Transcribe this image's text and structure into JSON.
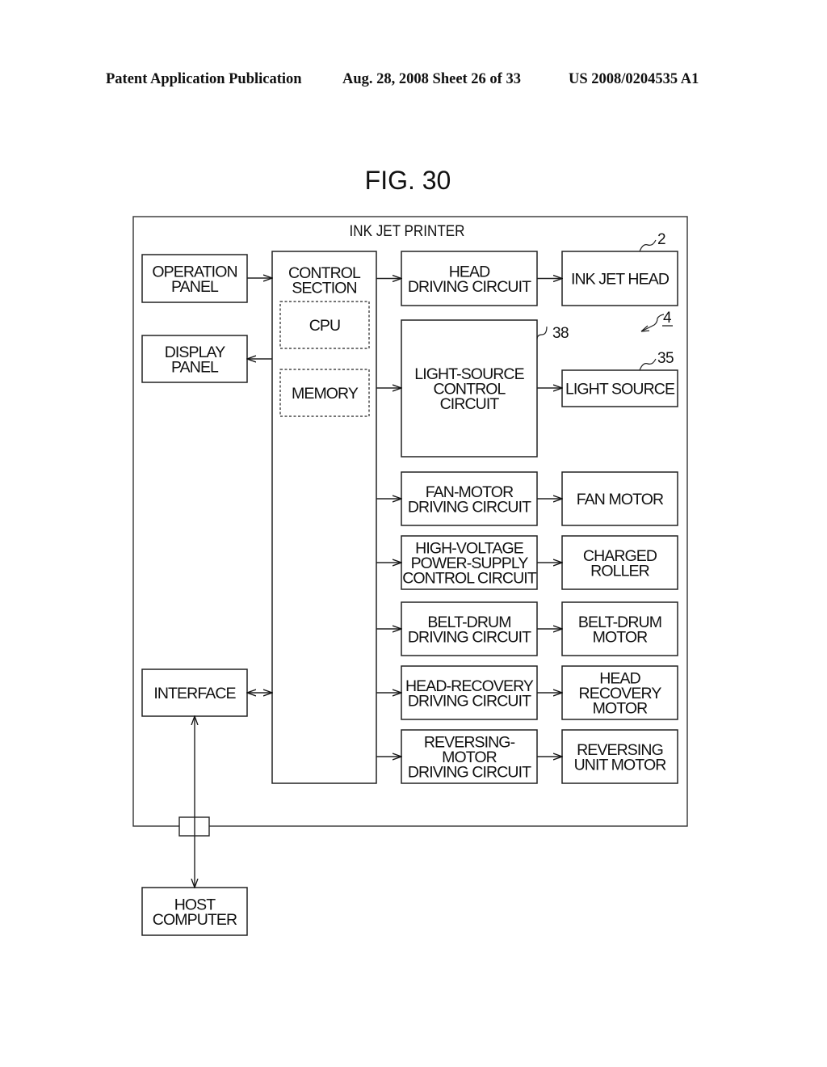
{
  "header": {
    "left": "Patent Application Publication",
    "middle": "Aug. 28, 2008  Sheet 26 of 33",
    "right": "US 2008/0204535 A1"
  },
  "figure": {
    "title": "FIG. 30",
    "container_label": "INK JET PRINTER",
    "blocks": [
      {
        "id": "operation-panel",
        "lines": [
          "OPERATION",
          "PANEL"
        ]
      },
      {
        "id": "display-panel",
        "lines": [
          "DISPLAY",
          "PANEL"
        ]
      },
      {
        "id": "interface",
        "lines": [
          "INTERFACE"
        ]
      },
      {
        "id": "host-computer",
        "lines": [
          "HOST",
          "COMPUTER"
        ]
      },
      {
        "id": "control-section",
        "lines": [
          "CONTROL",
          "SECTION"
        ]
      },
      {
        "id": "cpu",
        "lines": [
          "CPU"
        ],
        "style": "dashed"
      },
      {
        "id": "memory",
        "lines": [
          "MEMORY"
        ],
        "style": "dashed"
      },
      {
        "id": "head-driving-circuit",
        "lines": [
          "HEAD",
          "DRIVING CIRCUIT"
        ]
      },
      {
        "id": "light-source-control-circuit",
        "lines": [
          "LIGHT-SOURCE",
          "CONTROL",
          "CIRCUIT"
        ]
      },
      {
        "id": "fan-motor-driving-circuit",
        "lines": [
          "FAN-MOTOR",
          "DRIVING CIRCUIT"
        ]
      },
      {
        "id": "high-voltage-power-supply-control-circuit",
        "lines": [
          "HIGH-VOLTAGE",
          "POWER-SUPPLY",
          "CONTROL CIRCUIT"
        ]
      },
      {
        "id": "belt-drum-driving-circuit",
        "lines": [
          "BELT-DRUM",
          "DRIVING CIRCUIT"
        ]
      },
      {
        "id": "head-recovery-driving-circuit",
        "lines": [
          "HEAD-RECOVERY",
          "DRIVING CIRCUIT"
        ]
      },
      {
        "id": "reversing-motor-driving-circuit",
        "lines": [
          "REVERSING-",
          "MOTOR",
          "DRIVING CIRCUIT"
        ]
      },
      {
        "id": "ink-jet-head",
        "lines": [
          "INK JET HEAD"
        ]
      },
      {
        "id": "light-source",
        "lines": [
          "LIGHT SOURCE"
        ]
      },
      {
        "id": "fan-motor",
        "lines": [
          "FAN MOTOR"
        ]
      },
      {
        "id": "charged-roller",
        "lines": [
          "CHARGED",
          "ROLLER"
        ]
      },
      {
        "id": "belt-drum-motor",
        "lines": [
          "BELT-DRUM",
          "MOTOR"
        ]
      },
      {
        "id": "head-recovery-motor",
        "lines": [
          "HEAD",
          "RECOVERY",
          "MOTOR"
        ]
      },
      {
        "id": "reversing-unit-motor",
        "lines": [
          "REVERSING",
          "UNIT MOTOR"
        ]
      }
    ],
    "connections": [
      {
        "from": "operation-panel",
        "to": "control-section",
        "type": "arrow"
      },
      {
        "from": "control-section",
        "to": "display-panel",
        "type": "arrow"
      },
      {
        "from": "interface",
        "to": "control-section",
        "type": "bidirectional"
      },
      {
        "from": "interface",
        "to": "host-computer",
        "type": "bidirectional"
      },
      {
        "from": "control-section",
        "to": "head-driving-circuit",
        "type": "arrow"
      },
      {
        "from": "control-section",
        "to": "light-source-control-circuit",
        "type": "arrow"
      },
      {
        "from": "control-section",
        "to": "fan-motor-driving-circuit",
        "type": "arrow"
      },
      {
        "from": "control-section",
        "to": "high-voltage-power-supply-control-circuit",
        "type": "arrow"
      },
      {
        "from": "control-section",
        "to": "belt-drum-driving-circuit",
        "type": "arrow"
      },
      {
        "from": "control-section",
        "to": "head-recovery-driving-circuit",
        "type": "arrow"
      },
      {
        "from": "control-section",
        "to": "reversing-motor-driving-circuit",
        "type": "arrow"
      },
      {
        "from": "head-driving-circuit",
        "to": "ink-jet-head",
        "type": "arrow"
      },
      {
        "from": "light-source-control-circuit",
        "to": "light-source",
        "type": "arrow"
      },
      {
        "from": "fan-motor-driving-circuit",
        "to": "fan-motor",
        "type": "arrow"
      },
      {
        "from": "high-voltage-power-supply-control-circuit",
        "to": "charged-roller",
        "type": "arrow"
      },
      {
        "from": "belt-drum-driving-circuit",
        "to": "belt-drum-motor",
        "type": "arrow"
      },
      {
        "from": "head-recovery-driving-circuit",
        "to": "head-recovery-motor",
        "type": "arrow"
      },
      {
        "from": "reversing-motor-driving-circuit",
        "to": "reversing-unit-motor",
        "type": "arrow"
      }
    ],
    "reference_numerals": [
      {
        "label": "2",
        "target": "ink-jet-head"
      },
      {
        "label": "38",
        "target": "light-source-control-circuit"
      },
      {
        "label": "4",
        "target": "ink-jet-printer",
        "underlined": true
      },
      {
        "label": "35",
        "target": "light-source"
      }
    ]
  }
}
